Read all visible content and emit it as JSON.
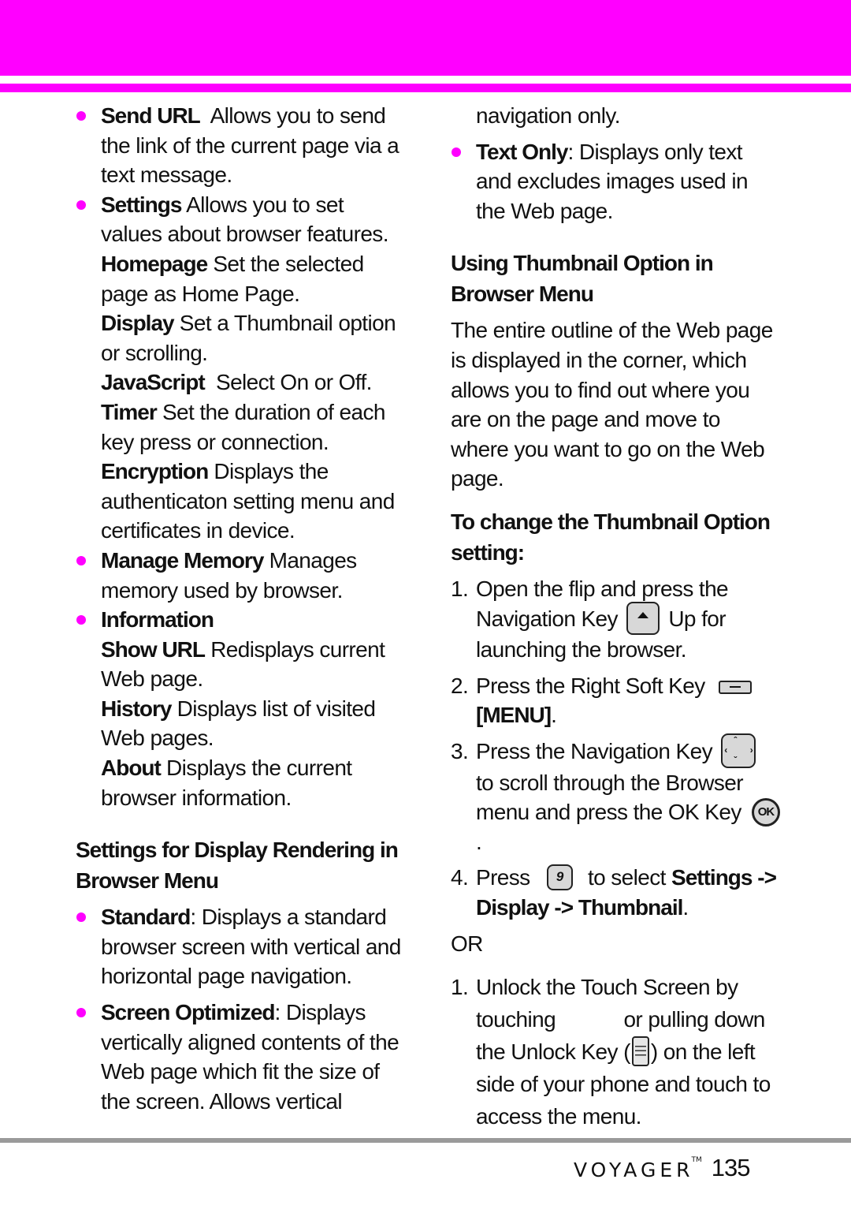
{
  "colors": {
    "accent": "#ff00ff",
    "rule": "#9a9a9a",
    "text": "#111111"
  },
  "left": {
    "bullets_top": [
      {
        "term": "Send URL",
        "text": "Allows you to send the link of the current page via a text message."
      },
      {
        "term": "Settings",
        "text": "Allows you to set values about browser features."
      }
    ],
    "settings_sub": [
      {
        "term": "Homepage",
        "text": "Set the selected page as Home Page."
      },
      {
        "term": "Display",
        "text": "Set a Thumbnail option or scrolling."
      },
      {
        "term": "JavaScript",
        "text": "Select On or Off."
      },
      {
        "term": "Timer",
        "text": "Set the duration of each key press or connection."
      },
      {
        "term": "Encryption",
        "text": "Displays the authenticaton setting menu and certificates in device."
      }
    ],
    "manage_memory": {
      "term": "Manage Memory",
      "text": "Manages memory used by browser."
    },
    "information": {
      "term": "Information"
    },
    "information_sub": [
      {
        "term": "Show URL",
        "text": "Redisplays current Web page."
      },
      {
        "term": "History",
        "text": "Displays list of visited Web pages."
      },
      {
        "term": "About",
        "text": "Displays the current browser information."
      }
    ],
    "section_heading": "Settings for Display Rendering in Browser Menu",
    "render_options": [
      {
        "term": "Standard",
        "text": ": Displays a standard browser screen with vertical and horizontal page navigation."
      },
      {
        "term": "Screen Optimized",
        "text": ": Displays vertically aligned contents of the Web page which fit the size of the screen. Allows vertical"
      }
    ]
  },
  "right": {
    "continuation": "navigation only.",
    "text_only": {
      "term": "Text Only",
      "text": ": Displays only text and excludes images used in the Web page."
    },
    "section_heading": "Using Thumbnail Option in Browser Menu",
    "paragraph": "The entire outline of the Web page is displayed in the corner, which allows you to find out where you are on the page and move to where you want to go on the Web page.",
    "procedure_heading": "To change the Thumbnail Option setting:",
    "steps": [
      {
        "num": "1.",
        "before": "Open the flip and press the Navigation Key",
        "icon": "navigation-up-key-icon",
        "after": "Up for launching the browser."
      },
      {
        "num": "2.",
        "before": "Press the Right Soft Key",
        "icon": "right-soft-key-icon",
        "after_bold": "[MENU]",
        "after": "."
      },
      {
        "num": "3.",
        "before": "Press the Navigation Key",
        "icon": "navigation-key-icon",
        "middle": "to scroll through the Browser menu and press the OK Key",
        "icon2": "ok-key-icon",
        "after": "."
      },
      {
        "num": "4.",
        "before": "Press",
        "icon": "key-9-icon",
        "key_label": "9",
        "middle": "to select",
        "bold1": "Settings ->",
        "bold2": "Display -> Thumbnail",
        "after": "."
      }
    ],
    "ok_label": "OK",
    "or_label": "OR",
    "alt_step": {
      "num": "1.",
      "before": "Unlock the Touch Screen by touching",
      "middle": "or pulling down the Unlock Key (",
      "icon": "unlock-key-icon",
      "after": ") on the left side of your phone and touch to access the menu."
    }
  },
  "footer": {
    "brand": "VOYAGER",
    "trademark": "TM",
    "page_number": "135"
  }
}
